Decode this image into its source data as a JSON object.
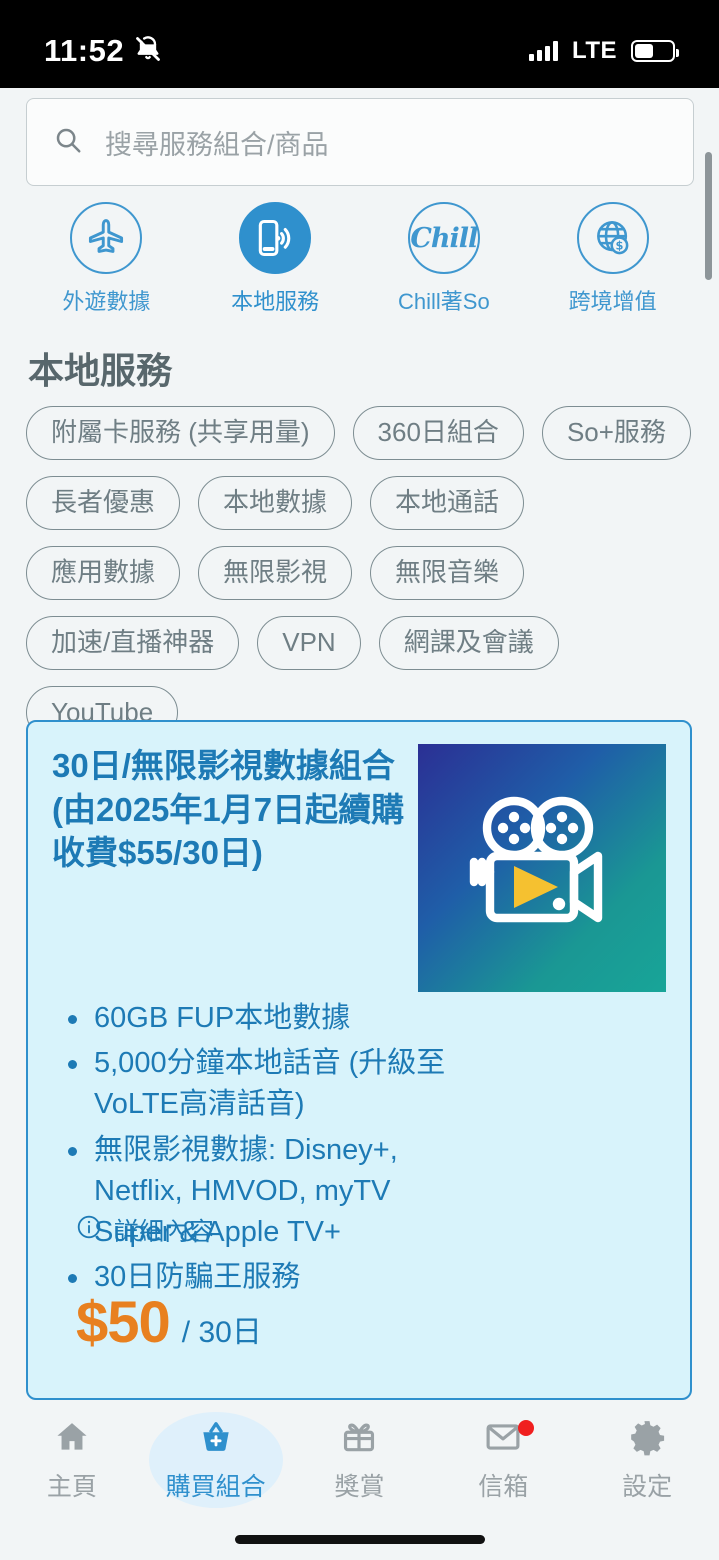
{
  "status_bar": {
    "time": "11:52",
    "silent_icon": "bell-slash-icon",
    "network": "LTE",
    "signal_bars": 4,
    "battery_level_pct": 50
  },
  "search": {
    "placeholder": "搜尋服務組合/商品",
    "icon": "search-icon",
    "value": ""
  },
  "categories": [
    {
      "label": "外遊數據",
      "icon": "airplane-icon",
      "active": false
    },
    {
      "label": "本地服務",
      "icon": "phone-signal-icon",
      "active": true
    },
    {
      "label": "Chill著So",
      "icon": "chill-logo-icon",
      "active": false
    },
    {
      "label": "跨境增值",
      "icon": "globe-dollar-icon",
      "active": false
    }
  ],
  "section": {
    "title": "本地服務"
  },
  "chips": [
    "附屬卡服務 (共享用量)",
    "360日組合",
    "So+服務",
    "長者優惠",
    "本地數據",
    "本地通話",
    "應用數據",
    "無限影視",
    "無限音樂",
    "加速/直播神器",
    "VPN",
    "網課及會議",
    "YouTube"
  ],
  "product_card": {
    "title": "30日/無限影視數據組合 (由2025年1月7日起續購收費$55/30日)",
    "image_icon": "movie-camera-icon",
    "bullets": [
      "60GB FUP本地數據",
      "5,000分鐘本地話音 (升級至VoLTE高清話音)",
      "無限影視數據: Disney+, Netflix, HMVOD, myTV Super & Apple TV+",
      "30日防騙王服務"
    ],
    "details_label": "詳細內容",
    "details_icon": "info-icon",
    "price": "$50",
    "price_period": "/ 30日"
  },
  "bottom_nav": [
    {
      "label": "主頁",
      "icon": "home-icon",
      "active": false,
      "badge": false
    },
    {
      "label": "購買組合",
      "icon": "basket-plus-icon",
      "active": true,
      "badge": false
    },
    {
      "label": "獎賞",
      "icon": "gift-icon",
      "active": false,
      "badge": false
    },
    {
      "label": "信箱",
      "icon": "mail-icon",
      "active": false,
      "badge": true
    },
    {
      "label": "設定",
      "icon": "gear-icon",
      "active": false,
      "badge": false
    }
  ],
  "colors": {
    "accent_blue": "#2f90cd",
    "card_bg": "#d8f3fb",
    "price_orange": "#e8801f",
    "chip_border": "#7d8d92",
    "title_gray": "#58676c"
  }
}
